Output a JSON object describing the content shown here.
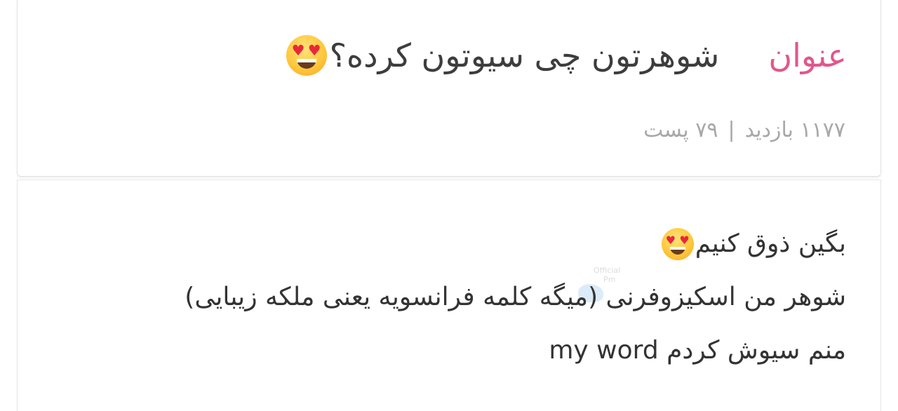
{
  "header": {
    "title_label": "عنوان",
    "title_text": "شوهرتون چی سیوتون کرده؟",
    "title_emoji": "heart-eyes-emoji",
    "views": "۱۱۷۷ بازدید",
    "separator": "|",
    "posts": "۷۹ پست"
  },
  "post": {
    "lines": [
      "بگین ذوق کنیم",
      "شوهر من اسکیزوفرنی (میگه کلمه فرانسویه یعنی ملکه زیبایی)",
      "منم سیوش کردم my word"
    ],
    "line1_emoji": "heart-eyes-emoji"
  },
  "watermark": {
    "text_1": "Official",
    "text_2": "Pm"
  },
  "colors": {
    "title_label": "#e0578c",
    "title_text": "#3d3d3d",
    "meta_text": "#a8a8a8",
    "body_text": "#333333",
    "card_border": "#e4e4e4"
  }
}
